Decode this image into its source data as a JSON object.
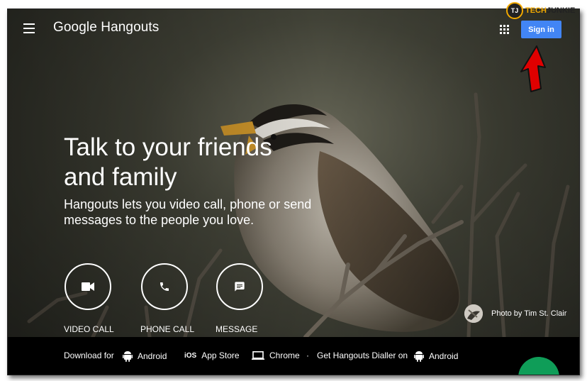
{
  "app": {
    "brand": "Google Hangouts",
    "signin_label": "Sign in",
    "accent_color": "#4285f4"
  },
  "watermark": {
    "logo_text": "TJ",
    "text_a": "TECH",
    "text_b": "JUNKIE"
  },
  "hero": {
    "headline": "Talk to your friends and family",
    "subtext": "Hangouts lets you video call, phone or send messages to the people you love.",
    "photo_credit": "Photo by Tim St. Clair"
  },
  "actions": [
    {
      "label": "VIDEO CALL",
      "icon": "video-camera-icon"
    },
    {
      "label": "PHONE CALL",
      "icon": "phone-icon"
    },
    {
      "label": "MESSAGE",
      "icon": "message-icon"
    }
  ],
  "footer": {
    "download_for": "Download for",
    "android_1": "Android",
    "app_store": "App Store",
    "chrome": "Chrome",
    "separator": "·",
    "dialler": "Get Hangouts Dialler on",
    "android_2": "Android"
  }
}
